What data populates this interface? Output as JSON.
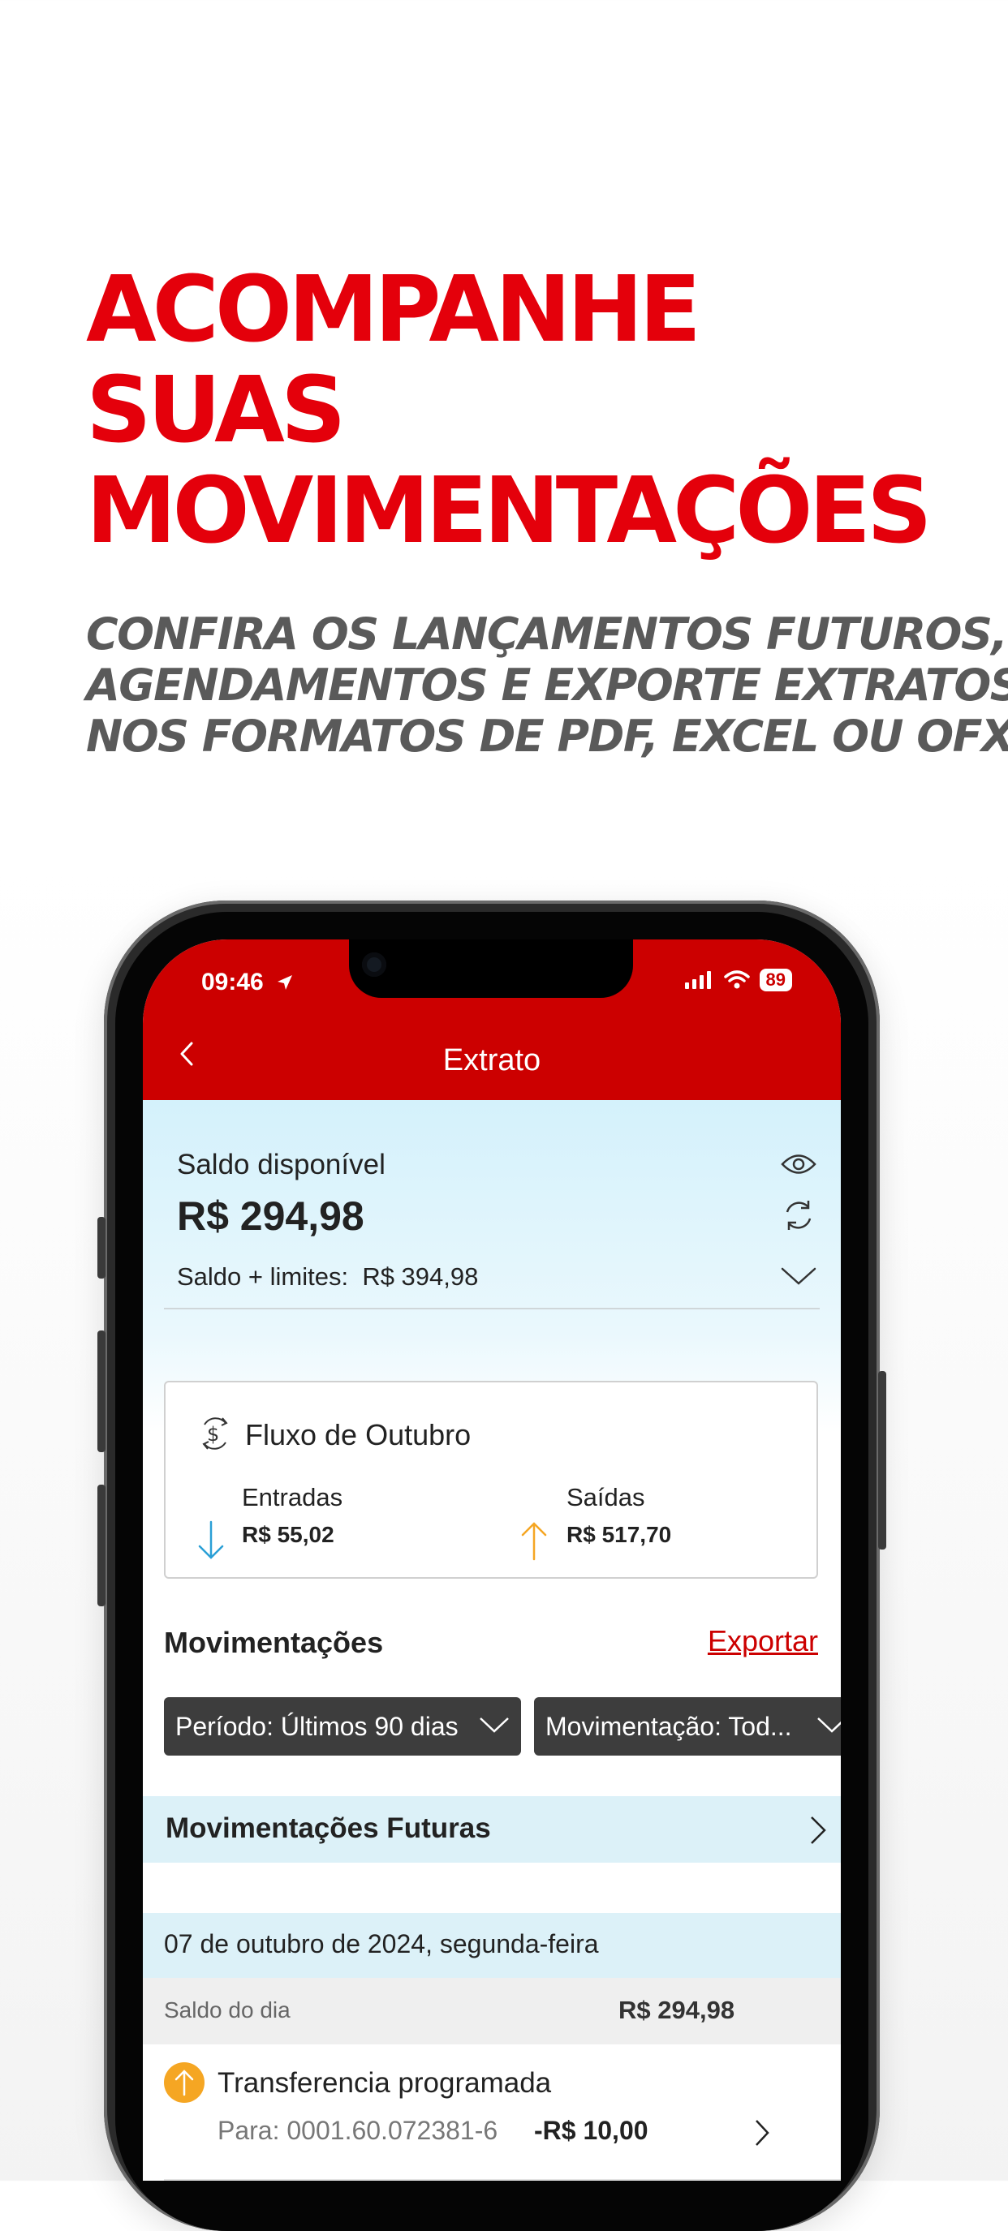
{
  "promo": {
    "headline": [
      "ACOMPANHE",
      "SUAS",
      "MOVIMENTAÇÕES"
    ],
    "subline": [
      "CONFIRA OS LANÇAMENTOS FUTUROS,",
      "AGENDAMENTOS E EXPORTE EXTRATOS",
      "NOS FORMATOS DE PDF, EXCEL OU OFX."
    ]
  },
  "status": {
    "time": "09:46",
    "battery": "89"
  },
  "header": {
    "title": "Extrato"
  },
  "balance": {
    "label": "Saldo disponível",
    "value": "R$ 294,98",
    "limits_label": "Saldo + limites:",
    "limits_value": "R$ 394,98"
  },
  "flow": {
    "title": "Fluxo de Outubro",
    "in_label": "Entradas",
    "in_value": "R$ 55,02",
    "out_label": "Saídas",
    "out_value": "R$ 517,70"
  },
  "movements": {
    "title": "Movimentações",
    "export_label": "Exportar",
    "filter_period": "Período: Últimos 90 dias",
    "filter_type": "Movimentação: Tod...",
    "future_label": "Movimentações Futuras"
  },
  "day": {
    "date": "07 de outubro de 2024, segunda-feira",
    "balance_label": "Saldo do dia",
    "balance_value": "R$ 294,98"
  },
  "transactions": [
    {
      "title": "Transferencia programada",
      "subtitle": "Para: 0001.60.072381-6",
      "amount": "-R$ 10,00"
    }
  ],
  "colors": {
    "brand_red": "#cc0000",
    "headline_red": "#e4000b",
    "accent_blue": "#dcf1f8",
    "warning_orange": "#f5a623"
  }
}
